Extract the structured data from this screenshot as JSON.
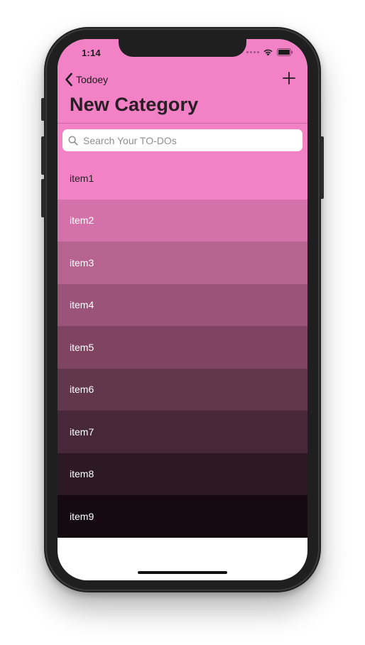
{
  "status_bar": {
    "time": "1:14"
  },
  "nav": {
    "back_label": "Todoey",
    "title": "New Category",
    "add_icon": "plus-icon",
    "back_icon": "chevron-left-icon"
  },
  "search": {
    "placeholder": "Search Your TO-DOs",
    "value": "",
    "icon": "magnifying-glass-icon"
  },
  "items": [
    {
      "label": "item1",
      "bg": "#f281c6",
      "fg": "#2b1f27"
    },
    {
      "label": "item2",
      "bg": "#d372aa",
      "fg": "#ffffff"
    },
    {
      "label": "item3",
      "bg": "#b6638f",
      "fg": "#ffffff"
    },
    {
      "label": "item4",
      "bg": "#9a5479",
      "fg": "#ffffff"
    },
    {
      "label": "item5",
      "bg": "#7e4462",
      "fg": "#ffffff"
    },
    {
      "label": "item6",
      "bg": "#62364d",
      "fg": "#ffffff"
    },
    {
      "label": "item7",
      "bg": "#47273a",
      "fg": "#ffffff"
    },
    {
      "label": "item8",
      "bg": "#2c1923",
      "fg": "#ffffff"
    },
    {
      "label": "item9",
      "bg": "#150a0f",
      "fg": "#ffffff"
    }
  ],
  "colors": {
    "accent": "#f281c6",
    "nav_text": "#1d1d1d"
  }
}
